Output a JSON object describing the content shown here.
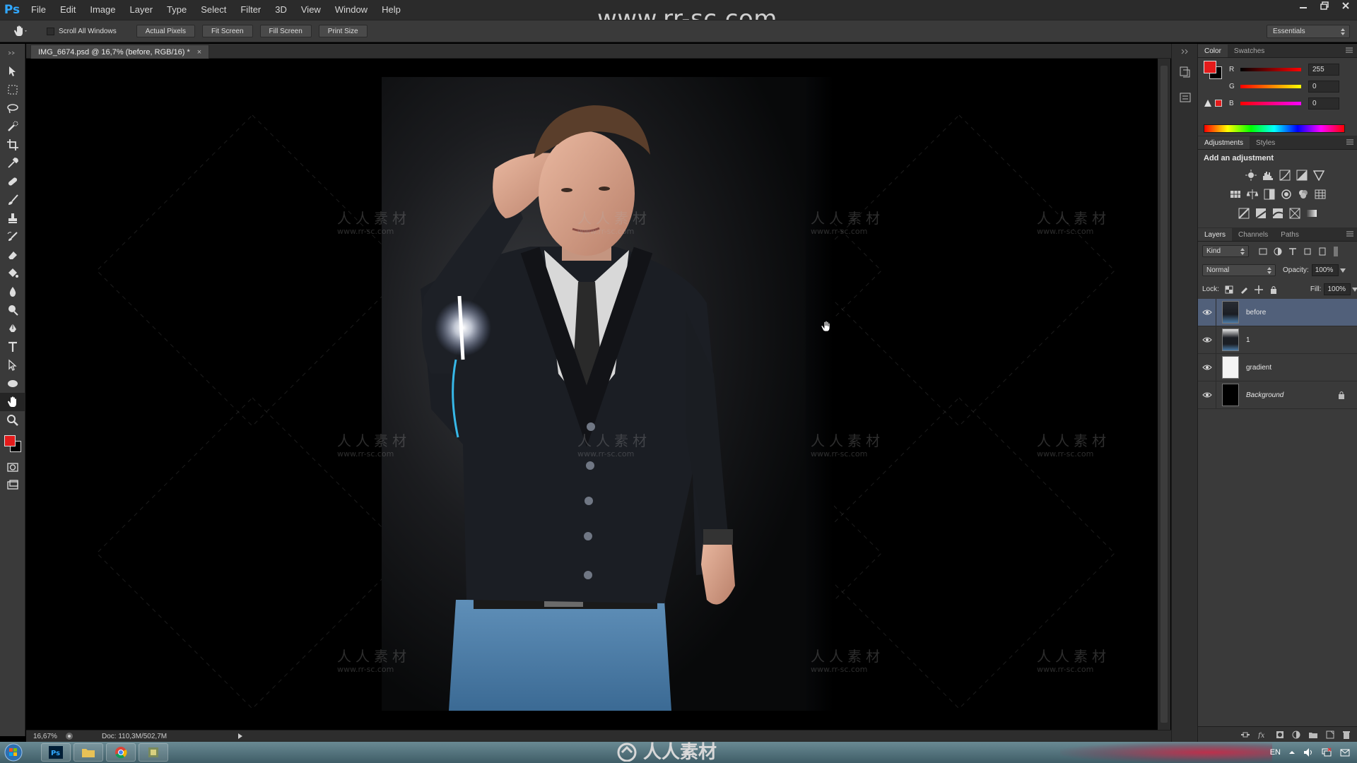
{
  "app": {
    "logo": "Ps",
    "menu": [
      "File",
      "Edit",
      "Image",
      "Layer",
      "Type",
      "Select",
      "Filter",
      "3D",
      "View",
      "Window",
      "Help"
    ],
    "watermark_url": "www.rr-sc.com"
  },
  "options_bar": {
    "scroll_all_windows": "Scroll All Windows",
    "scroll_all_checked": false,
    "buttons": [
      "Actual Pixels",
      "Fit Screen",
      "Fill Screen",
      "Print Size"
    ],
    "workspace": "Essentials"
  },
  "document": {
    "tab_title": "IMG_6674.psd @ 16,7% (before, RGB/16) *",
    "close": "×"
  },
  "canvas_watermarks": {
    "chinese": "人人素材",
    "url": "www.rr-sc.com"
  },
  "status_bar": {
    "zoom": "16,67%",
    "doc_size": "Doc: 110,3M/502,7M"
  },
  "panels": {
    "color": {
      "tabs": [
        "Color",
        "Swatches"
      ],
      "channels": [
        {
          "label": "R",
          "value": "255"
        },
        {
          "label": "G",
          "value": "0"
        },
        {
          "label": "B",
          "value": "0"
        }
      ],
      "foreground": "#e41b1b",
      "background": "#000000"
    },
    "adjustments": {
      "tabs": [
        "Adjustments",
        "Styles"
      ],
      "title": "Add an adjustment"
    },
    "layers": {
      "tabs": [
        "Layers",
        "Channels",
        "Paths"
      ],
      "filter_kind": "Kind",
      "blend_mode": "Normal",
      "opacity_label": "Opacity:",
      "opacity": "100%",
      "lock_label": "Lock:",
      "fill_label": "Fill:",
      "fill": "100%",
      "items": [
        {
          "name": "before",
          "selected": true
        },
        {
          "name": "1",
          "selected": false
        },
        {
          "name": "gradient",
          "selected": false
        },
        {
          "name": "Background",
          "selected": false,
          "locked": true
        }
      ]
    }
  },
  "taskbar": {
    "language": "EN",
    "watermark": "人人素材"
  }
}
